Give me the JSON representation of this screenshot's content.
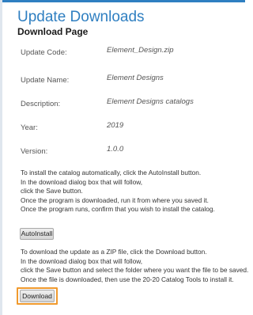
{
  "header": {
    "title": "Update Downloads",
    "subtitle": "Download Page"
  },
  "fields": [
    {
      "label": "Update Code:",
      "value": "Element_Design.zip"
    },
    {
      "label": "Update Name:",
      "value": "Element Designs"
    },
    {
      "label": "Description:",
      "value": "Element Designs catalogs"
    },
    {
      "label": "Year:",
      "value": "2019"
    },
    {
      "label": "Version:",
      "value": "1.0.0"
    }
  ],
  "auto_instructions": [
    "To install the catalog automatically, click the AutoInstall button.",
    "In the download dialog box that will follow,",
    "click the Save button.",
    "Once the program is downloaded, run it from where you saved it.",
    "Once the program runs, confirm that you wish to install the catalog."
  ],
  "autoinstall_button": "AutoInstall",
  "zip_instructions": [
    "To download the update as a ZIP file, click the Download button.",
    "In the download dialog box that will follow,",
    "click the Save button and select the folder where you want the file to be saved.",
    "Once the file is downloaded, then use the 20-20 Catalog Tools to install it."
  ],
  "download_button": "Download",
  "colors": {
    "accent": "#2f7fc1",
    "highlight": "#f09a2e"
  }
}
